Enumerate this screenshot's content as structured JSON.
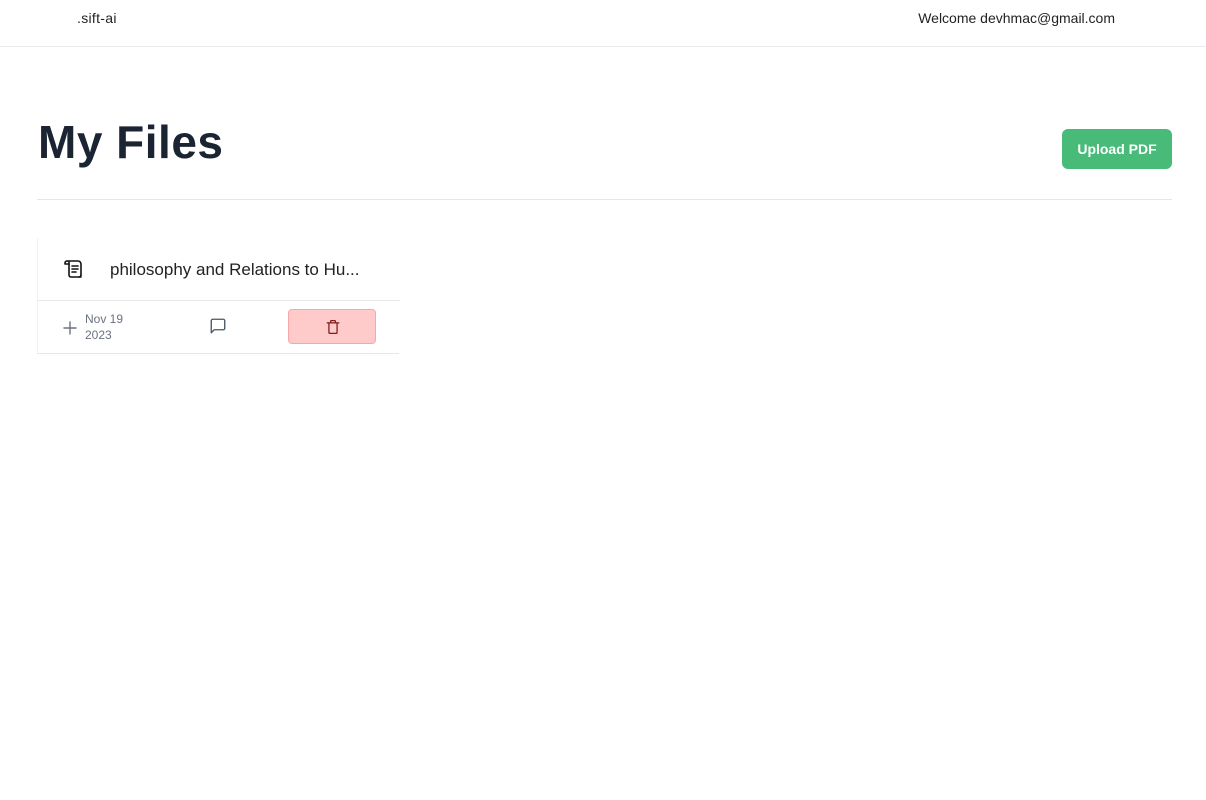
{
  "navbar": {
    "brand": ".sift-ai",
    "welcome": "Welcome devhmac@gmail.com"
  },
  "page": {
    "title": "My Files",
    "upload_label": "Upload PDF"
  },
  "files": [
    {
      "name": "philosophy and Relations to Hu...",
      "date_line1": "Nov 19",
      "date_line2": "2023",
      "icons": {
        "file": "scroll-icon",
        "add": "plus-icon",
        "chat": "message-square-icon",
        "delete": "trash-icon"
      }
    }
  ],
  "colors": {
    "accent": "#48bb78",
    "title": "#1b2433",
    "delete_bg": "#fecaca",
    "delete_icon": "#7f1d1d"
  }
}
